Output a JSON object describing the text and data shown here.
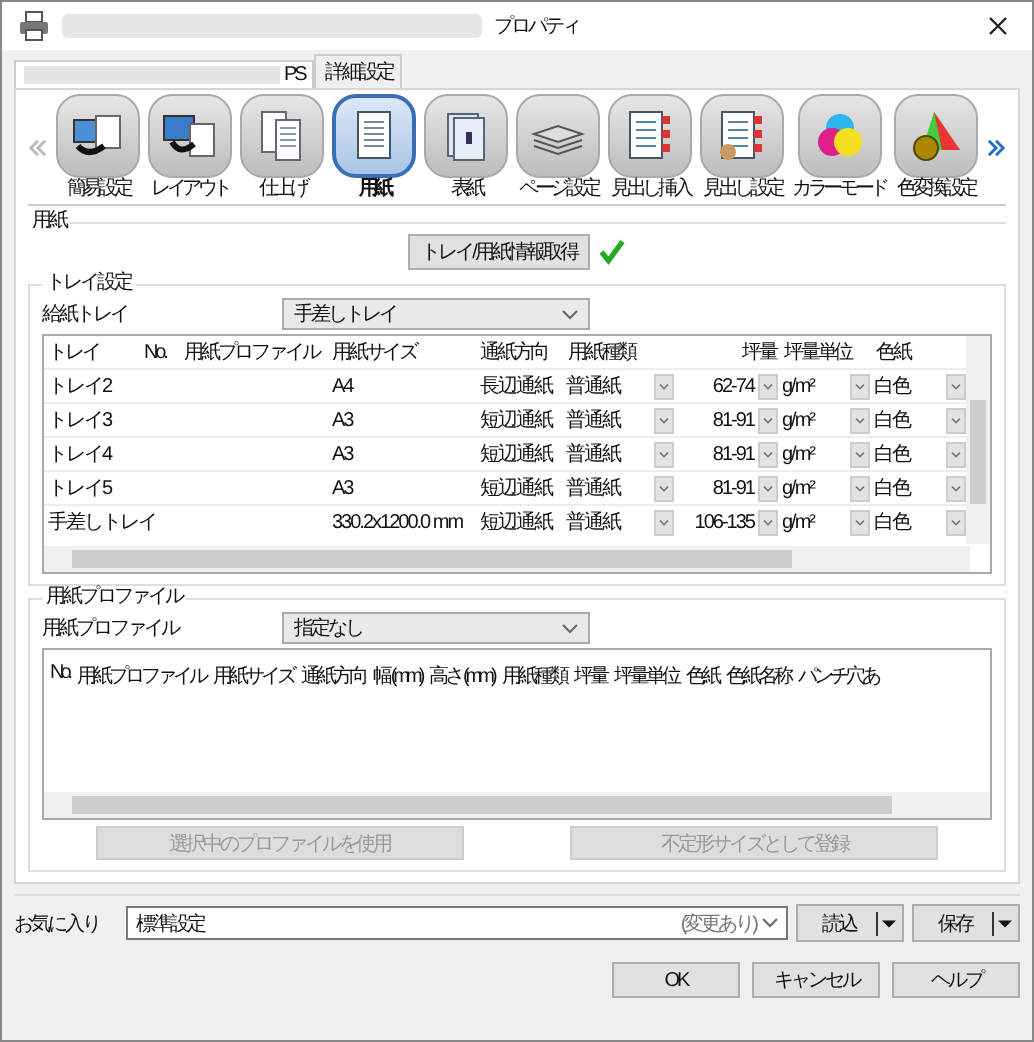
{
  "window": {
    "title": "プロパティ"
  },
  "tabs": [
    {
      "label": "PS",
      "selected": true
    },
    {
      "label": "詳細設定",
      "selected": false
    }
  ],
  "toolbar": [
    {
      "label": "簡易設定",
      "kind": "easy",
      "selected": false
    },
    {
      "label": "レイアウト",
      "kind": "layout",
      "selected": false
    },
    {
      "label": "仕上げ",
      "kind": "finish",
      "selected": false
    },
    {
      "label": "用紙",
      "kind": "paper",
      "selected": true
    },
    {
      "label": "表紙",
      "kind": "cover",
      "selected": false
    },
    {
      "label": "ページ設定",
      "kind": "pages",
      "selected": false
    },
    {
      "label": "見出し挿入",
      "kind": "tabs",
      "selected": false
    },
    {
      "label": "見出し設定",
      "kind": "tabset",
      "selected": false
    },
    {
      "label": "カラーモード",
      "kind": "color",
      "selected": false
    },
    {
      "label": "色変換設定",
      "kind": "convert",
      "selected": false
    }
  ],
  "paper": {
    "title": "用紙",
    "fetch_button": "トレイ/用紙情報取得",
    "fetched": true,
    "tray_settings": {
      "title": "トレイ設定",
      "feed_label": "給紙トレイ",
      "feed_value": "手差しトレイ",
      "columns": [
        "トレイ",
        "No.",
        "用紙プロファイル",
        "用紙サイズ",
        "通紙方向",
        "用紙種類",
        "坪量",
        "坪量単位",
        "色紙"
      ],
      "rows": [
        {
          "cells": [
            "トレイ2",
            "",
            "",
            "A4",
            "長辺通紙",
            "普通紙",
            "62-74",
            "g/m²",
            "白色"
          ]
        },
        {
          "cells": [
            "トレイ3",
            "",
            "",
            "A3",
            "短辺通紙",
            "普通紙",
            "81-91",
            "g/m²",
            "白色"
          ]
        },
        {
          "cells": [
            "トレイ4",
            "",
            "",
            "A3",
            "短辺通紙",
            "普通紙",
            "81-91",
            "g/m²",
            "白色"
          ]
        },
        {
          "cells": [
            "トレイ5",
            "",
            "",
            "A3",
            "短辺通紙",
            "普通紙",
            "81-91",
            "g/m²",
            "白色"
          ]
        },
        {
          "cells": [
            "手差しトレイ",
            "",
            "",
            "330.2x1200.0 mm",
            "短辺通紙",
            "普通紙",
            "106-135",
            "g/m²",
            "白色"
          ]
        }
      ]
    },
    "profile": {
      "title": "用紙プロファイル",
      "label": "用紙プロファイル",
      "value": "指定なし",
      "columns": [
        "No.",
        "用紙プロファイル",
        "用紙サイズ",
        "通紙方向",
        "幅 (mm)",
        "高さ (mm)",
        "用紙種類",
        "坪量",
        "坪量単位",
        "色紙",
        "色紙名称",
        "パンチ穴あ"
      ],
      "buttons": [
        {
          "label": "選択中のプロファイルを使用",
          "disabled": true
        },
        {
          "label": "不定形サイズとして登録",
          "disabled": true
        }
      ]
    }
  },
  "favorites": {
    "label": "お気に入り",
    "value": "標準設定",
    "note": "(変更あり)",
    "buttons": [
      "読込",
      "保存"
    ]
  },
  "buttons": [
    "OK",
    "キャンセル",
    "ヘルプ"
  ]
}
